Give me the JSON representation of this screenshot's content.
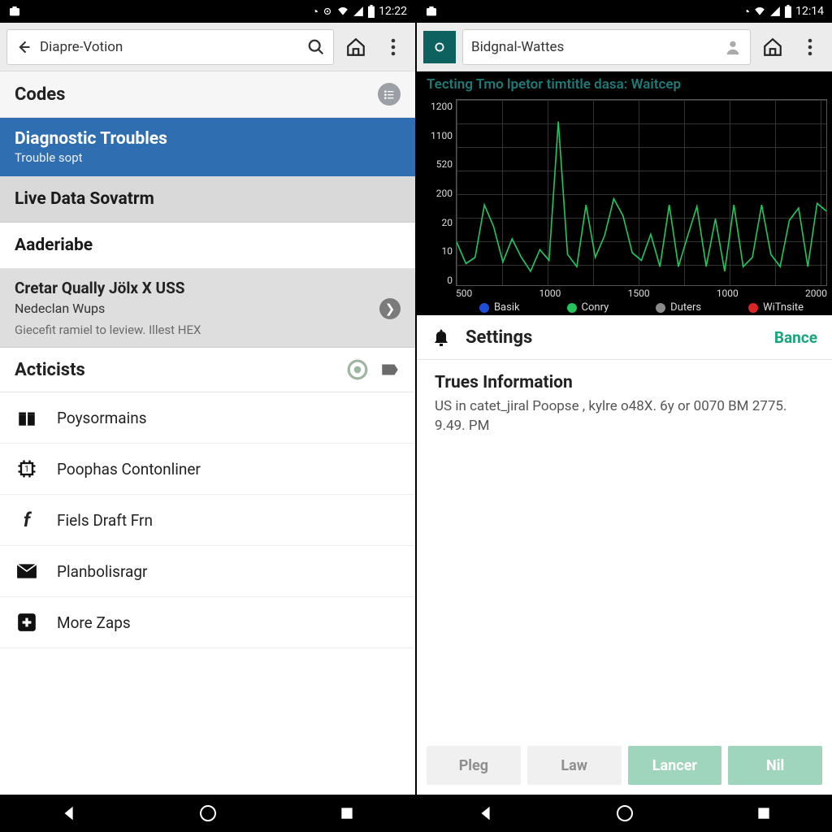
{
  "left": {
    "status": {
      "time": "12:22"
    },
    "search_value": "Diapre-Votion",
    "sec_codes": "Codes",
    "row_sel_title": "Diagnostic Troubles",
    "row_sel_sub": "Trouble sopt",
    "row_live": "Live Data Sovatrm",
    "row_aad": "Aaderiabe",
    "card_title": "Cretar Qually Jölx X USS",
    "card_sub": "Nedeclan Wups",
    "card_desc": "Giecefit ramiel to leview. Illest HEX",
    "sec_act": "Acticists",
    "items": [
      {
        "label": "Poysormains"
      },
      {
        "label": "Poophas Contonliner"
      },
      {
        "label": "Fiels Draft Frn"
      },
      {
        "label": "Planbolisragr"
      },
      {
        "label": "More Zaps"
      }
    ]
  },
  "right": {
    "status": {
      "time": "12:14"
    },
    "search_value": "Bidgnal-Wattes",
    "chart_title": "Tecting Tmo lpetor timtitle dasa: Waitcep",
    "legend": [
      "Basik",
      "Conry",
      "Duters",
      "WiTnsite"
    ],
    "legend_colors": [
      "#1d4ed8",
      "#22c55e",
      "#8a8a8a",
      "#dc2626"
    ],
    "settings_label": "Settings",
    "settings_action": "Bance",
    "info_title": "Trues Information",
    "info_desc": "US in catet_jiral Poopse , kylre o48X. 6y or 0070 BM 2775. 9.49. PM",
    "btns": [
      "Pleg",
      "Law",
      "Lancer",
      "Nil"
    ]
  },
  "chart_data": {
    "type": "line",
    "title": "Tecting Tmo lpetor timtitle dasa: Waitcep",
    "x_ticks": [
      500,
      1000,
      1500,
      1000,
      2000
    ],
    "y_ticks": [
      0,
      10,
      20,
      200,
      520,
      1100,
      1200
    ],
    "ylim": [
      0,
      1200
    ],
    "series": [
      {
        "name": "Conry",
        "color": "#22c55e",
        "values": [
          280,
          140,
          180,
          520,
          380,
          150,
          300,
          180,
          90,
          230,
          160,
          1060,
          200,
          120,
          520,
          180,
          320,
          560,
          450,
          210,
          160,
          330,
          120,
          520,
          120,
          320,
          510,
          120,
          430,
          90,
          520,
          120,
          180,
          520,
          200,
          120,
          420,
          500,
          120,
          530,
          480
        ]
      }
    ]
  }
}
